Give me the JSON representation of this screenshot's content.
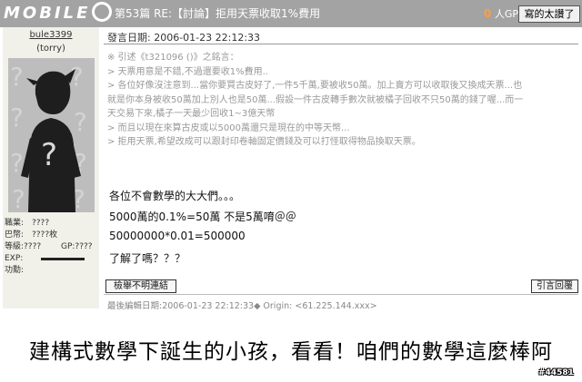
{
  "header": {
    "logo_text": "MOBILE",
    "topic": "第53篇 RE:【討論】拒用天票收取1%費用",
    "gp_count": "0",
    "gp_label": "人GP",
    "nice_button": "寫的太讚了"
  },
  "author": {
    "name": "bule3399",
    "title": "(torry)",
    "stats": [
      {
        "label": "職業:",
        "value": "????"
      },
      {
        "label": "巴幣:",
        "value": "????枚"
      },
      {
        "label": "等級:????",
        "value": "GP:????"
      },
      {
        "label": "EXP:",
        "value": ""
      },
      {
        "label": "功勳:",
        "value": ""
      }
    ]
  },
  "post": {
    "date": "發言日期: 2006-01-23 22:12:33",
    "quote_lines": [
      "※ 引述《t321096 ()》之銘言：",
      "> 天票用意是不錯,不過還要收1%費用..",
      "> 各位好像沒注意到...當你要買古皮好了,一件5千萬,要被收50萬。加上賣方可以收取後又換成天票...也",
      "就是你本身被收50萬加上別人也是50萬...假設一件古皮轉手數次就被橘子回收不只50萬的錢了喔...而一",
      "天交易下來,橘子一天最少回收1~3億天幣",
      "> 而且以現在來算古皮或以5000萬還只是現在的中等天幣...",
      "> 拒用天票,希望改成可以跟封印卷軸固定價錢及可以打怪取得物品換取天票。"
    ],
    "body_lines": [
      "各位不會數學的大大們。。。",
      "5000萬的0.1%=50萬 不是5萬唷＠＠",
      "50000000*0.01=500000",
      "了解了嗎？？？"
    ],
    "report_button": "檢舉不明連結",
    "reply_button": "引言回覆",
    "edited": "最後編輯日期:2006-01-23 22:12:33◆ Origin: <61.225.144.xxx>"
  },
  "caption": "建構式數學下誕生的小孩，看看！咱們的數學這麼棒阿",
  "watermark": "#44581"
}
